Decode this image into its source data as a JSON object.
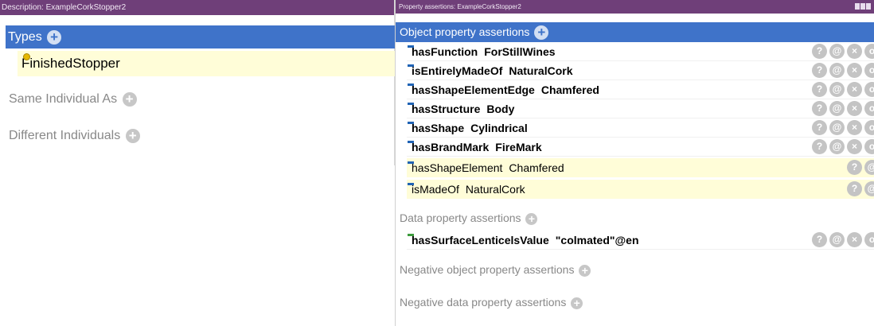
{
  "left_panel": {
    "title": "Description: ExampleCorkStopper2",
    "types_label": "Types",
    "type_value": "FinishedStopper",
    "same_individual_label": "Same Individual As",
    "different_individuals_label": "Different Individuals"
  },
  "right_panel": {
    "title": "Property assertions: ExampleCorkStopper2",
    "object_header": "Object property assertions",
    "object_assertions": [
      {
        "property": "hasFunction",
        "value": "ForStillWines"
      },
      {
        "property": "isEntirelyMadeOf",
        "value": "NaturalCork"
      },
      {
        "property": "hasShapeElementEdge",
        "value": "Chamfered"
      },
      {
        "property": "hasStructure",
        "value": "Body"
      },
      {
        "property": "hasShape",
        "value": "Cylindrical"
      },
      {
        "property": "hasBrandMark",
        "value": "FireMark"
      }
    ],
    "inferred_assertions": [
      {
        "property": "hasShapeElement",
        "value": "Chamfered"
      },
      {
        "property": "isMadeOf",
        "value": "NaturalCork"
      }
    ],
    "data_header": "Data property assertions",
    "data_assertions": [
      {
        "property": "hasSurfaceLenticelsValue",
        "value": "\"colmated\"@en"
      }
    ],
    "negative_object_header": "Negative object property assertions",
    "negative_data_header": "Negative data property assertions"
  },
  "icons": {
    "add": "+",
    "explain": "?",
    "annotate": "@",
    "delete": "×",
    "edit": "o"
  },
  "colors": {
    "title_bar": "#6f3f79",
    "selected_header": "#3f73c9",
    "inferred_row": "#fffdd8",
    "object_property_icon": "#1f63b5",
    "data_property_icon": "#3c9b3c"
  }
}
